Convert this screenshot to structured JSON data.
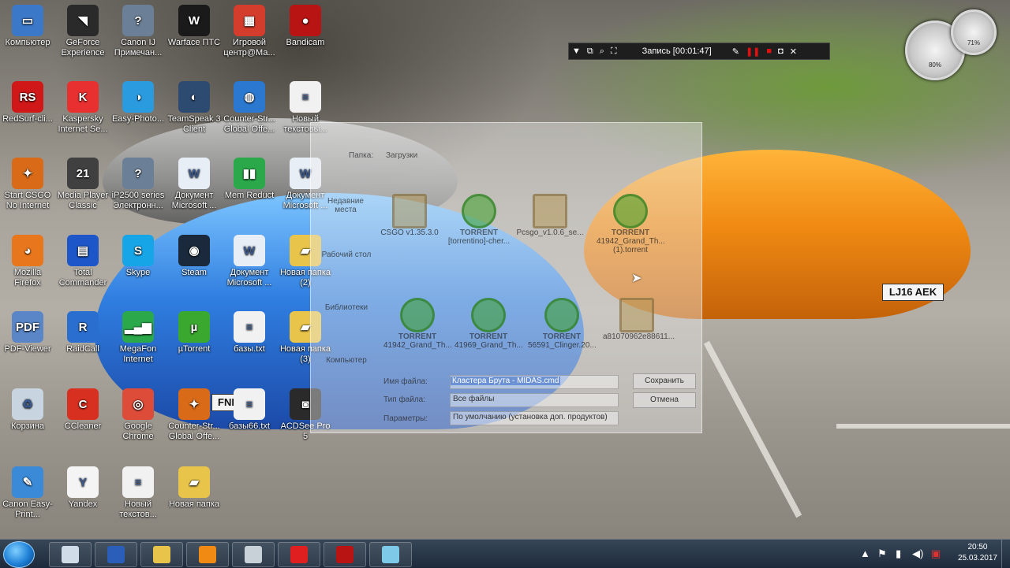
{
  "desktop_icons": [
    {
      "label": "Компьютер",
      "icon": "computer-icon",
      "color": "#3c78c8",
      "glyph": "▭"
    },
    {
      "label": "GeForce Experience",
      "icon": "nvidia-icon",
      "color": "#2a2a2a",
      "glyph": "◥"
    },
    {
      "label": "Canon IJ Примечан...",
      "icon": "canon-printer-icon",
      "color": "#6b7f96",
      "glyph": "?"
    },
    {
      "label": "Warface ПТС",
      "icon": "warface-icon",
      "color": "#1a1a1a",
      "glyph": "W"
    },
    {
      "label": "Игровой центр@Ма...",
      "icon": "game-center-icon",
      "color": "#d43c2c",
      "glyph": "▦"
    },
    {
      "label": "Bandicam",
      "icon": "bandicam-icon",
      "color": "#b81414",
      "glyph": "●"
    },
    {
      "label": "RedSurf-cli...",
      "icon": "redsurf-icon",
      "color": "#d01818",
      "glyph": "RS"
    },
    {
      "label": "Kaspersky Internet Se...",
      "icon": "kaspersky-icon",
      "color": "#e83030",
      "glyph": "K"
    },
    {
      "label": "Easy-Photo...",
      "icon": "easy-photo-icon",
      "color": "#2b9be0",
      "glyph": "◑"
    },
    {
      "label": "TeamSpeak 3 Client",
      "icon": "teamspeak-icon",
      "color": "#2d4a70",
      "glyph": "◐"
    },
    {
      "label": "Counter-Str... Global Offe...",
      "icon": "csgo-icon",
      "color": "#2a78d0",
      "glyph": "◍"
    },
    {
      "label": "Новый текстовы...",
      "icon": "text-file-icon",
      "color": "#f1f1f1",
      "glyph": "≡"
    },
    {
      "label": "Start CSGO No Internet",
      "icon": "csgo-shortcut-icon",
      "color": "#d86a18",
      "glyph": "✦"
    },
    {
      "label": "Media Player Classic",
      "icon": "media-player-icon",
      "color": "#404040",
      "glyph": "21"
    },
    {
      "label": "iP2500 series Электронн...",
      "icon": "canon-manual-icon",
      "color": "#6b7f96",
      "glyph": "?"
    },
    {
      "label": "Документ Microsoft ...",
      "icon": "word-document-icon",
      "color": "#e8eef6",
      "glyph": "W"
    },
    {
      "label": "Mem Reduct",
      "icon": "mem-reduct-icon",
      "color": "#2aa84a",
      "glyph": "▮▮"
    },
    {
      "label": "Документ Microsoft ...",
      "icon": "word-document-icon",
      "color": "#e8eef6",
      "glyph": "W"
    },
    {
      "label": "Mozilla Firefox",
      "icon": "firefox-icon",
      "color": "#e8761c",
      "glyph": "◕"
    },
    {
      "label": "Total Commander",
      "icon": "total-commander-icon",
      "color": "#1c56c8",
      "glyph": "▤"
    },
    {
      "label": "Skype",
      "icon": "skype-icon",
      "color": "#16a6e8",
      "glyph": "S"
    },
    {
      "label": "Steam",
      "icon": "steam-icon",
      "color": "#1a2a3c",
      "glyph": "◉"
    },
    {
      "label": "Документ Microsoft ...",
      "icon": "word-document-icon",
      "color": "#e8eef6",
      "glyph": "W"
    },
    {
      "label": "Новая папка (2)",
      "icon": "folder-icon",
      "color": "#e8c44a",
      "glyph": "▰"
    },
    {
      "label": "PDF-Viewer",
      "icon": "pdf-viewer-icon",
      "color": "#5a86c8",
      "glyph": "PDF"
    },
    {
      "label": "RaidCall",
      "icon": "raidcall-icon",
      "color": "#2a6fd0",
      "glyph": "R"
    },
    {
      "label": "MegaFon Internet",
      "icon": "megafon-icon",
      "color": "#2aa84a",
      "glyph": "▂▄▆"
    },
    {
      "label": "µTorrent",
      "icon": "utorrent-icon",
      "color": "#3aa82e",
      "glyph": "µ"
    },
    {
      "label": "базы.txt",
      "icon": "text-file-icon",
      "color": "#f1f1f1",
      "glyph": "≡"
    },
    {
      "label": "Новая папка (3)",
      "icon": "folder-icon",
      "color": "#e8c44a",
      "glyph": "▰"
    },
    {
      "label": "Корзина",
      "icon": "recycle-bin-icon",
      "color": "#c8d4e0",
      "glyph": "♻"
    },
    {
      "label": "CCleaner",
      "icon": "ccleaner-icon",
      "color": "#d83020",
      "glyph": "C"
    },
    {
      "label": "Google Chrome",
      "icon": "chrome-icon",
      "color": "#dd4b39",
      "glyph": "◎"
    },
    {
      "label": "Counter-Str... Global Offe...",
      "icon": "csgo-icon",
      "color": "#d86a18",
      "glyph": "✦"
    },
    {
      "label": "базы66.txt",
      "icon": "text-file-icon",
      "color": "#f1f1f1",
      "glyph": "≡"
    },
    {
      "label": "ACDSee Pro 5",
      "icon": "acdsee-icon",
      "color": "#2a2a2a",
      "glyph": "◙"
    },
    {
      "label": "Canon Easy-Print...",
      "icon": "canon-easy-print-icon",
      "color": "#3a8ad8",
      "glyph": "✎"
    },
    {
      "label": "Yandex",
      "icon": "yandex-icon",
      "color": "#f4f4f4",
      "glyph": "Y"
    },
    {
      "label": "Новый текстов...",
      "icon": "text-file-icon",
      "color": "#f1f1f1",
      "glyph": "≡"
    },
    {
      "label": "Новая папка",
      "icon": "folder-icon",
      "color": "#e8c44a",
      "glyph": "▰"
    }
  ],
  "recorder": {
    "title": "Запись [00:01:47]"
  },
  "gadgets": {
    "cpu": "80%",
    "memory": "71%"
  },
  "wallpaper": {
    "plate": "LJ16 AEK",
    "plate2": "FNE"
  },
  "save_dialog": {
    "folder_label": "Папка:",
    "folder_value": "Загрузки",
    "sidebar": [
      "Недавние места",
      "Рабочий стол",
      "Библиотеки",
      "Компьютер"
    ],
    "files": [
      {
        "name": "CSGO v1.35.3.0",
        "cap": ""
      },
      {
        "name": "[torrentino]-cher...",
        "cap": "TORRENT"
      },
      {
        "name": "Pcsgo_v1.0.6_se...",
        "cap": ""
      },
      {
        "name": "41942_Grand_Th... (1).torrent",
        "cap": "TORRENT"
      },
      {
        "name": "41942_Grand_Th...",
        "cap": "TORRENT"
      },
      {
        "name": "41969_Grand_Th...",
        "cap": "TORRENT"
      },
      {
        "name": "56591_Clinger.20...",
        "cap": "TORRENT"
      },
      {
        "name": "a81070962e88611...",
        "cap": ""
      }
    ],
    "filename_label": "Имя файла:",
    "filename_value": "Кластера Брута - MIDAS.cmd",
    "filetype_label": "Тип файла:",
    "filetype_value": "Все файлы",
    "params_label": "Параметры:",
    "params_value": "По умолчанию (установка доп. продуктов)",
    "save_label": "Сохранить",
    "cancel_label": "Отмена"
  },
  "taskbar": {
    "apps": [
      {
        "name": "explorer-window",
        "icon": "window-icon",
        "color": "#d0dce8"
      },
      {
        "name": "word",
        "icon": "word-icon",
        "color": "#2a5eb8"
      },
      {
        "name": "file-explorer",
        "icon": "folder-icon",
        "color": "#e8c44a"
      },
      {
        "name": "media-player",
        "icon": "media-player-icon",
        "color": "#f08a12"
      },
      {
        "name": "calculator",
        "icon": "calculator-icon",
        "color": "#c8d0d8"
      },
      {
        "name": "yandex-browser",
        "icon": "yandex-icon",
        "color": "#e02020"
      },
      {
        "name": "bandicam",
        "icon": "bandicam-icon",
        "color": "#b81414"
      },
      {
        "name": "app",
        "icon": "app-icon",
        "color": "#7ec8e8"
      }
    ],
    "time": "20:50",
    "date": "25.03.2017"
  }
}
